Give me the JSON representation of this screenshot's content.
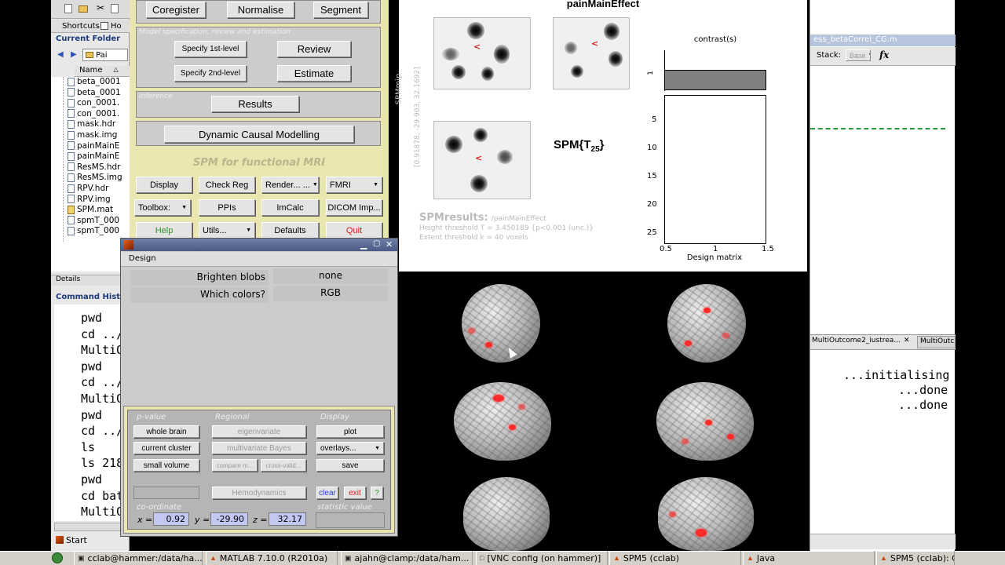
{
  "matlab": {
    "shortcuts_label": "Shortcuts",
    "how_to_add_label": "Ho",
    "current_folder_title": "Current Folder",
    "path_fragment": "Pai",
    "name_col": "Name",
    "sort_marker": "△",
    "files": [
      "beta_0001",
      "beta_0001",
      "con_0001.",
      "con_0001.",
      "mask.hdr",
      "mask.img",
      "painMainE",
      "painMainE",
      "ResMS.hdr",
      "ResMS.img",
      "RPV.hdr",
      "RPV.img",
      "SPM.mat",
      "spmT_000",
      "spmT_000"
    ],
    "details_label": "Details",
    "command_history_title": "Command Histo",
    "commands": [
      "pwd",
      "cd ../",
      "MultiO",
      "pwd",
      "cd ../",
      "MultiO",
      "pwd",
      "cd ../",
      "ls",
      "ls 218",
      "pwd",
      "cd bat",
      "MultiO"
    ],
    "start_label": "Start",
    "editor_tab": "ess_betaCorrel_CG.m",
    "stack_label": "Stack:",
    "stack_value": "Base",
    "fx_label": "fx",
    "tab1": "MultiOutcome2_iustrea...",
    "tab2": "MultiOutc",
    "console": [
      "...initialising",
      "...done",
      "...done"
    ]
  },
  "spm_menu": {
    "coregister": "Coregister",
    "normalise": "Normalise",
    "segment": "Segment",
    "model_label": "Model specification, review and estimation",
    "specify1": "Specify 1st-level",
    "review": "Review",
    "specify2": "Specify 2nd-level",
    "estimate": "Estimate",
    "inference_label": "Inference",
    "results": "Results",
    "dcm": "Dynamic Causal Modelling",
    "spm_title": "SPM for functional MRI",
    "display": "Display",
    "check_reg": "Check Reg",
    "render": "Render... ...",
    "fmri": "FMRI",
    "toolbox": "Toolbox:",
    "ppis": "PPIs",
    "imcalc": "ImCalc",
    "dicom": "DICOM Imp...",
    "help": "Help",
    "utils": "Utils...",
    "defaults": "Defaults",
    "quit": "Quit"
  },
  "interactive": {
    "menu_design": "Design",
    "brighten_label": "Brighten blobs",
    "brighten_value": "none",
    "colors_label": "Which colors?",
    "colors_value": "RGB",
    "pvalue_label": "p-value",
    "regional_label": "Regional",
    "display_label": "Display",
    "whole_brain": "whole brain",
    "eigenvariate": "eigenvariate",
    "plot": "plot",
    "current_cluster": "current cluster",
    "multivariate_bayes": "multivariate Bayes",
    "overlays": "overlays...",
    "small_volume": "small volume",
    "compare": "compare m...",
    "cross_valid": "cross-valid...",
    "save": "save",
    "hemodynamics": "Hemodynamics",
    "clear": "clear",
    "exit": "exit",
    "question": "?",
    "coordinate_label": "co-ordinate",
    "statistic_label": "statistic value",
    "x_label": "x =",
    "x_value": "0.92",
    "y_label": "y =",
    "y_value": "-29.90",
    "z_label": "z =",
    "z_value": "32.17"
  },
  "graphics": {
    "title": "painMainEffect",
    "spmmip_label": "SPMmip",
    "coord_text": "[0.91878, -29.903, 32.1692]",
    "stat_label": "SPM{T",
    "stat_sub": "25",
    "stat_close": "}",
    "contrast_label": "contrast(s)",
    "contrast_tick": "1",
    "design_yticks": [
      "5",
      "10",
      "15",
      "20",
      "25"
    ],
    "design_xticks": [
      "0.5",
      "1",
      "1.5"
    ],
    "design_xlabel": "Design matrix",
    "results_title": "SPMresults:",
    "results_path": "/painMainEffect",
    "height_threshold": "Height threshold T = 3.450189  {p<0.001 (unc.)}",
    "extent_threshold": "Extent threshold k = 40 voxels"
  },
  "taskbar": {
    "items": [
      "cclab@hammer:/data/ha...",
      "MATLAB  7.10.0 (R2010a)",
      "ajahn@clamp:/data/ham...",
      "[VNC config (on hammer)]",
      "SPM5 (cclab)",
      "Java",
      "SPM5 (cclab): G"
    ]
  }
}
